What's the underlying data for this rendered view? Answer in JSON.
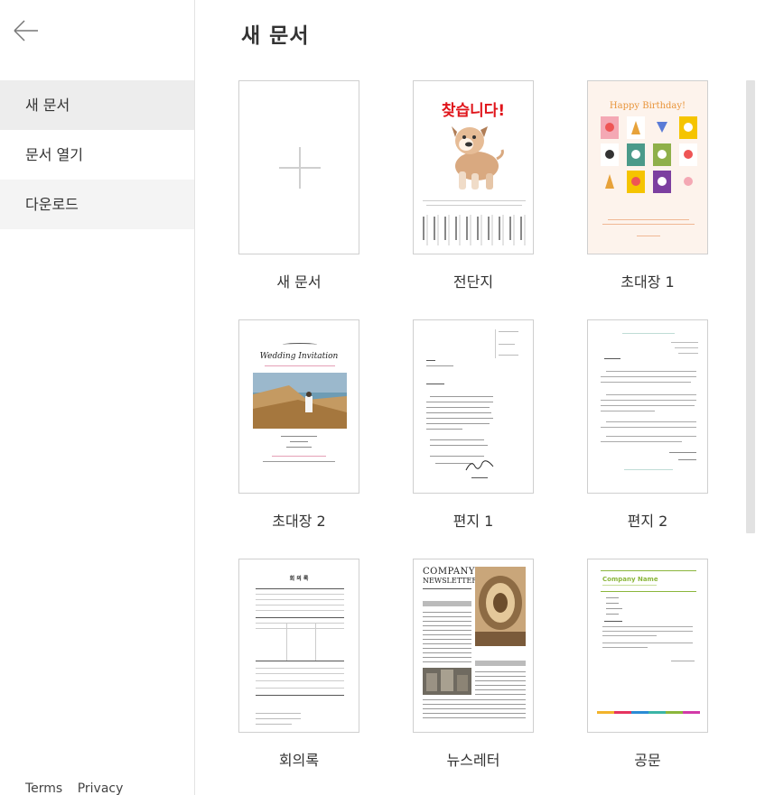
{
  "sidebar": {
    "back_icon": "arrow-left-icon",
    "items": [
      {
        "label": "새 문서"
      },
      {
        "label": "문서 열기"
      },
      {
        "label": "다운로드"
      }
    ],
    "footer": {
      "terms": "Terms",
      "privacy": "Privacy"
    }
  },
  "main": {
    "title": "새 문서",
    "templates": [
      {
        "label": "새 문서"
      },
      {
        "label": "전단지",
        "heading": "찾습니다!"
      },
      {
        "label": "초대장 1",
        "heading": "Happy Birthday!"
      },
      {
        "label": "초대장 2",
        "heading": "Wedding Invitation"
      },
      {
        "label": "편지 1"
      },
      {
        "label": "편지 2"
      },
      {
        "label": "회의록",
        "heading": "회 의 록"
      },
      {
        "label": "뉴스레터",
        "heading": "COMPANY",
        "heading2": "NEWSLETTER"
      },
      {
        "label": "공문",
        "heading": "Company Name"
      }
    ]
  },
  "colors": {
    "flyer_heading": "#e0151b",
    "birthday_heading": "#e8943a",
    "birthday_bg": "#fdf3ec",
    "company_green": "#8bb63c",
    "nav_active_bg": "#ededed"
  }
}
